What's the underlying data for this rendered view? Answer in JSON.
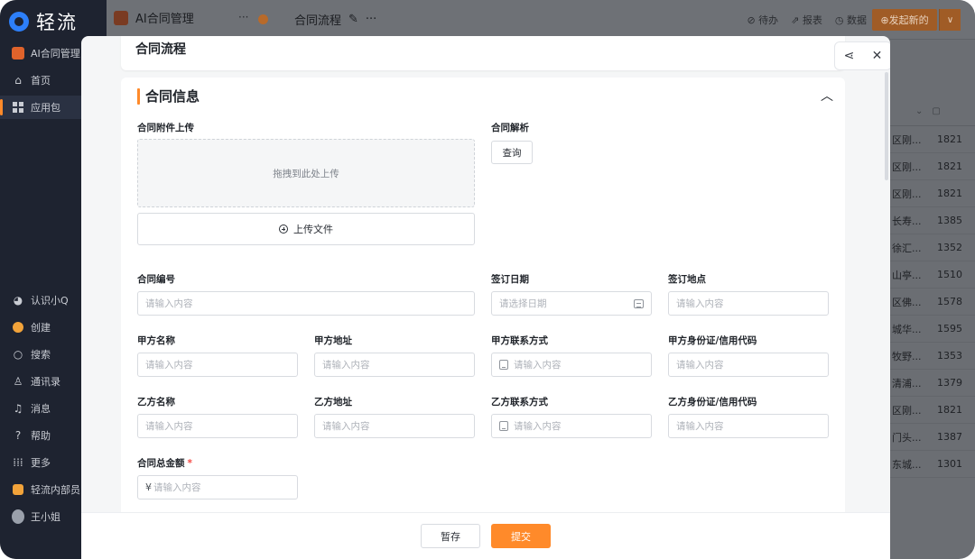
{
  "sidebar": {
    "logo": "轻流",
    "app_item": "AI合同管理",
    "items": [
      {
        "label": "首页",
        "icon": "home-icon"
      },
      {
        "label": "应用包",
        "icon": "apps-grid-icon"
      }
    ],
    "bottom_items": [
      {
        "label": "认识小Q",
        "icon": "assistant-icon"
      },
      {
        "label": "创建",
        "icon": "create-icon"
      },
      {
        "label": "搜索",
        "icon": "search-icon"
      },
      {
        "label": "通讯录",
        "icon": "contacts-icon"
      },
      {
        "label": "消息",
        "icon": "bell-icon"
      },
      {
        "label": "帮助",
        "icon": "help-icon"
      },
      {
        "label": "更多",
        "icon": "more-grid-icon"
      },
      {
        "label": "轻流内部员",
        "icon": "workspace-icon"
      },
      {
        "label": "王小姐",
        "icon": "user-avatar-icon"
      }
    ]
  },
  "topbar": {
    "app_title": "AI合同管理",
    "more": "···",
    "flow_title": "合同流程",
    "flow_more": "···",
    "right_links": [
      "待办",
      "报表",
      "数据"
    ],
    "launch_label": "发起新的"
  },
  "background_table": {
    "rows": [
      [
        "区刚...",
        "1821"
      ],
      [
        "区刚...",
        "1821"
      ],
      [
        "区刚...",
        "1821"
      ],
      [
        "长寿...",
        "1385"
      ],
      [
        "徐汇...",
        "1352"
      ],
      [
        "山亭...",
        "1510"
      ],
      [
        "区佛...",
        "1578"
      ],
      [
        "城华...",
        "1595"
      ],
      [
        "牧野...",
        "1353"
      ],
      [
        "清浦...",
        "1379"
      ],
      [
        "区刚...",
        "1821"
      ],
      [
        "门头...",
        "1387"
      ],
      [
        "东城...",
        "1301"
      ]
    ]
  },
  "modal": {
    "title": "合同流程",
    "section_title": "合同信息",
    "upload": {
      "label": "合同附件上传",
      "dropzone_text": "拖拽到此处上传",
      "button_label": "上传文件"
    },
    "parse": {
      "label": "合同解析",
      "button_label": "查询"
    },
    "fields": {
      "contract_no": {
        "label": "合同编号",
        "placeholder": "请输入内容"
      },
      "sign_date": {
        "label": "签订日期",
        "placeholder": "请选择日期"
      },
      "sign_place": {
        "label": "签订地点",
        "placeholder": "请输入内容"
      },
      "party_a_name": {
        "label": "甲方名称",
        "placeholder": "请输入内容"
      },
      "party_a_address": {
        "label": "甲方地址",
        "placeholder": "请输入内容"
      },
      "party_a_phone": {
        "label": "甲方联系方式",
        "placeholder": "请输入内容"
      },
      "party_a_id": {
        "label": "甲方身份证/信用代码",
        "placeholder": "请输入内容"
      },
      "party_b_name": {
        "label": "乙方名称",
        "placeholder": "请输入内容"
      },
      "party_b_address": {
        "label": "乙方地址",
        "placeholder": "请输入内容"
      },
      "party_b_phone": {
        "label": "乙方联系方式",
        "placeholder": "请输入内容"
      },
      "party_b_id": {
        "label": "乙方身份证/信用代码",
        "placeholder": "请输入内容"
      },
      "total_amount": {
        "label": "合同总金额",
        "required_mark": "*",
        "currency": "¥",
        "placeholder": "请输入内容"
      }
    },
    "footer": {
      "draft_label": "暂存",
      "submit_label": "提交"
    }
  },
  "colors": {
    "accent": "#ff8a2a",
    "required": "#f54a45",
    "sidebar_bg": "#1e2330"
  }
}
